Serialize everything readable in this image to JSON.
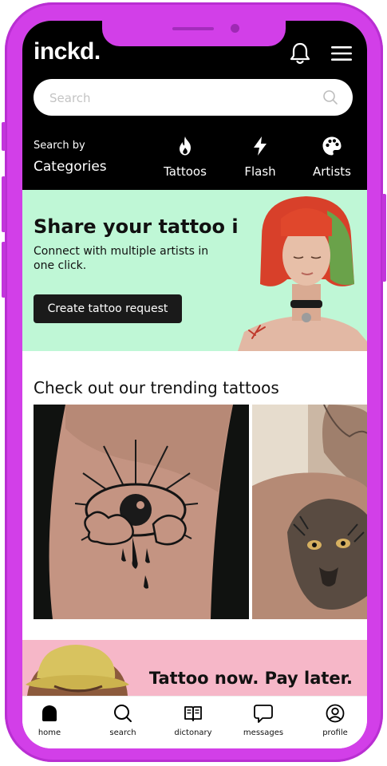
{
  "app": {
    "logo": "inckd."
  },
  "header": {
    "bell_icon": "bell-icon",
    "menu_icon": "hamburger-menu-icon"
  },
  "search": {
    "placeholder": "Search",
    "value": "",
    "icon": "search-icon"
  },
  "categories": {
    "subtitle": "Search by",
    "title": "Categories",
    "items": [
      {
        "label": "Tattoos",
        "icon": "flame-icon"
      },
      {
        "label": "Flash",
        "icon": "lightning-icon"
      },
      {
        "label": "Artists",
        "icon": "palette-icon"
      }
    ]
  },
  "promo": {
    "title": "Share your tattoo idea",
    "body": "Connect with multiple artists in one click.",
    "cta": "Create tattoo request",
    "bg_color": "#bff7d6"
  },
  "trending": {
    "title": "Check out our trending tattoos"
  },
  "pay_later": {
    "text": "Tattoo now. Pay later.",
    "bg_color": "#f6b7c8"
  },
  "bottom_nav": [
    {
      "label": "home",
      "icon": "home-icon",
      "active": true
    },
    {
      "label": "search",
      "icon": "search-icon"
    },
    {
      "label": "dictonary",
      "icon": "book-icon"
    },
    {
      "label": "messages",
      "icon": "message-icon"
    },
    {
      "label": "profile",
      "icon": "profile-icon"
    }
  ],
  "colors": {
    "device": "#d23fe8",
    "header_bg": "#000000"
  }
}
